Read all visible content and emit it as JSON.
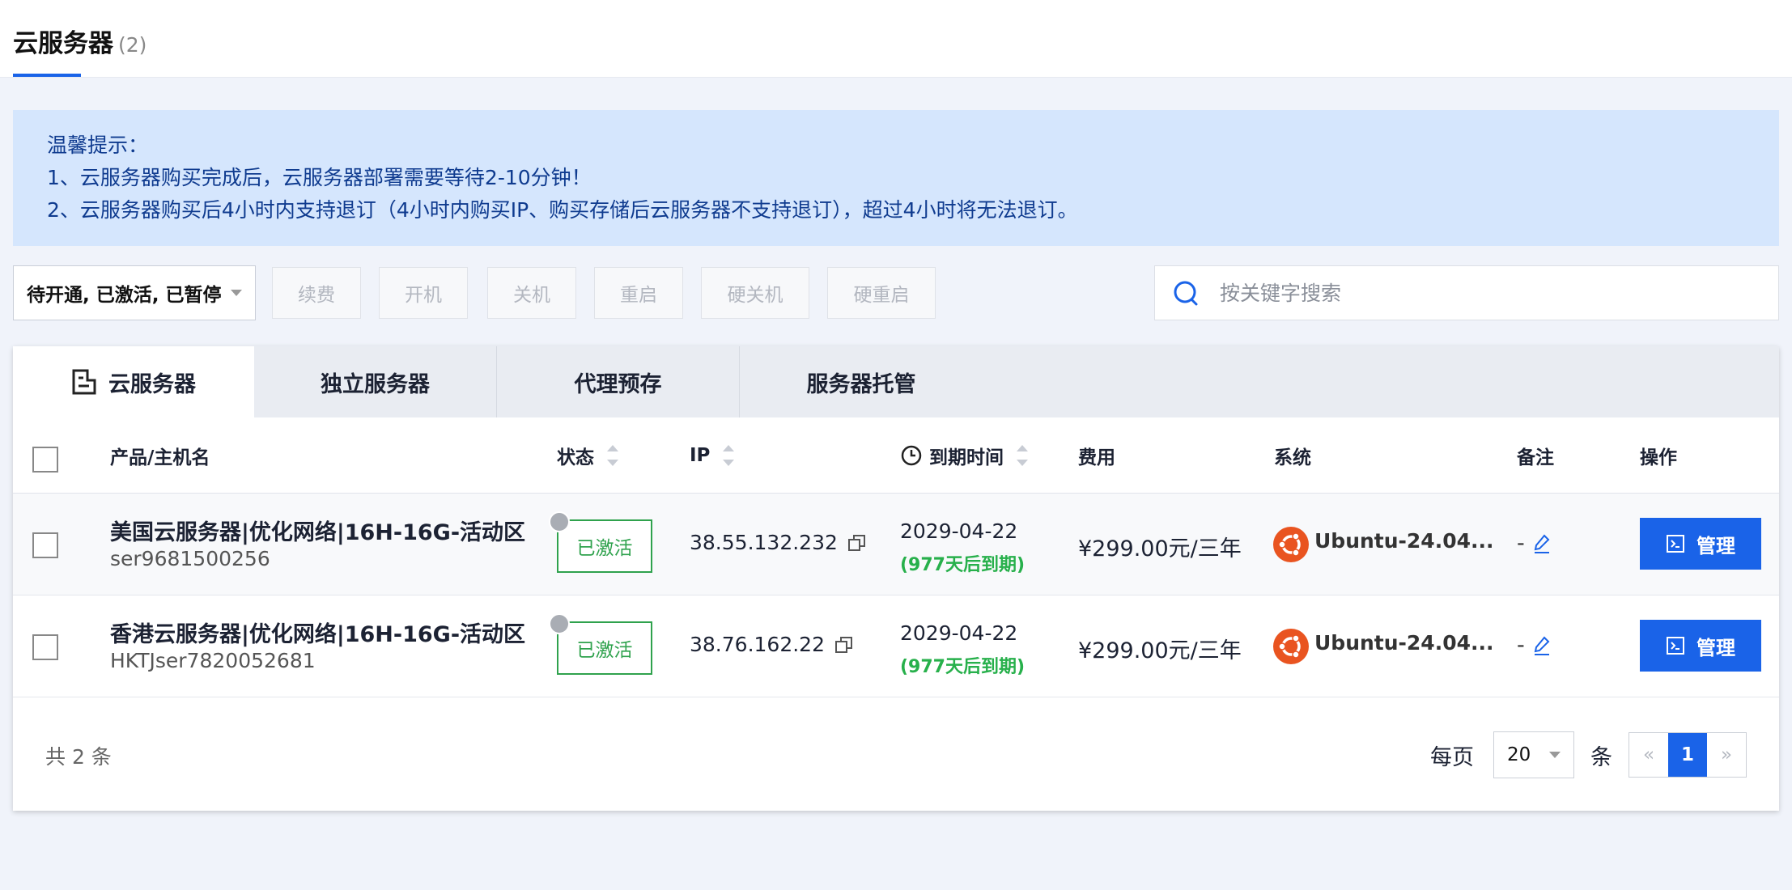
{
  "header": {
    "title": "云服务器",
    "count": "(2)"
  },
  "notice": {
    "title": "温馨提示：",
    "line1": "1、云服务器购买完成后，云服务器部署需要等待2-10分钟！",
    "line2": "2、云服务器购买后4小时内支持退订（4小时内购买IP、购买存储后云服务器不支持退订），超过4小时将无法退订。"
  },
  "toolbar": {
    "status_filter": "待开通, 已激活, 已暂停",
    "buttons": [
      "续费",
      "开机",
      "关机",
      "重启",
      "硬关机",
      "硬重启"
    ],
    "search_placeholder": "按关键字搜索"
  },
  "tabs": [
    "云服务器",
    "独立服务器",
    "代理预存",
    "服务器托管"
  ],
  "table": {
    "columns": [
      "产品/主机名",
      "状态",
      "IP",
      "到期时间",
      "费用",
      "系统",
      "备注",
      "操作"
    ],
    "rows": [
      {
        "product": "美国云服务器|优化网络|16H-16G-活动区",
        "host": "ser9681500256",
        "status": "已激活",
        "ip": "38.55.132.232",
        "expiry": "2029-04-22",
        "remaining": "(977天后到期)",
        "fee": "¥299.00元/三年",
        "os": "Ubuntu-24.04...",
        "note": "-",
        "action": "管理"
      },
      {
        "product": "香港云服务器|优化网络|16H-16G-活动区",
        "host": "HKTJser7820052681",
        "status": "已激活",
        "ip": "38.76.162.22",
        "expiry": "2029-04-22",
        "remaining": "(977天后到期)",
        "fee": "¥299.00元/三年",
        "os": "Ubuntu-24.04...",
        "note": "-",
        "action": "管理"
      }
    ]
  },
  "footer": {
    "total": "共 2 条",
    "per_page_label": "每页",
    "page_size": "20",
    "unit": "条",
    "prev": "«",
    "current_page": "1",
    "next": "»"
  },
  "colors": {
    "primary": "#1a63e8",
    "success": "#2fa24d",
    "notice_bg": "#d5e6fd",
    "ubuntu": "#e95420"
  },
  "icons": {
    "tab_cloud": "server-list-icon",
    "search": "search-icon",
    "expiry": "clock-icon",
    "copy": "copy-icon",
    "os": "ubuntu-icon",
    "edit": "edit-pencil-icon",
    "manage": "terminal-icon"
  }
}
